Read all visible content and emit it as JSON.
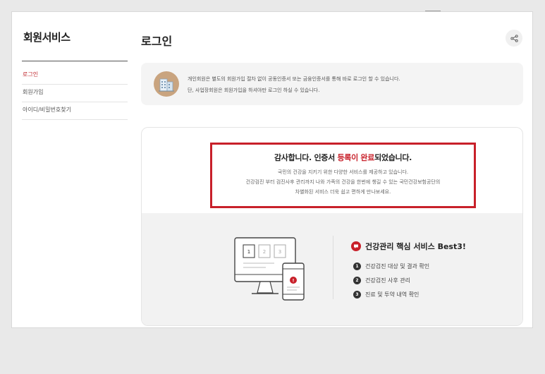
{
  "sidebar": {
    "title": "회원서비스",
    "items": [
      {
        "label": "로그인"
      },
      {
        "label": "회원가입"
      },
      {
        "label": "아이디/비밀번호찾기"
      }
    ]
  },
  "page": {
    "title": "로그인"
  },
  "notice": {
    "line1": "개인회원은 별도의 회원가입 절차 없이 공동인증서 또는 금융인증서를 통해 바로 로그인 할 수 있습니다.",
    "line2": "단, 사업장회원은 회원가입을 하셔야만 로그인 하실 수 있습니다."
  },
  "result": {
    "thanks_prefix": "감사합니다. 인증서 ",
    "thanks_accent": "등록이 완료",
    "thanks_suffix": "되었습니다.",
    "desc1": "국민의 건강을 지키기 위한 다양한 서비스를 제공하고 있습니다.",
    "desc2": "건강검진 부터 검진사후 관리까지 나와 가족의 건강을 한번에 챙길 수 있는 국민건강보험공단의",
    "desc3": "차별화된 서비스 더욱 쉽고 편하게 만나보세요."
  },
  "best": {
    "title": "건강관리 핵심 서비스 Best3!",
    "items": [
      {
        "num": "1",
        "label": "건강검진 대상 및 결과 확인"
      },
      {
        "num": "2",
        "label": "건강검진 사후 관리"
      },
      {
        "num": "3",
        "label": "진료 및 투약 내역 확인"
      }
    ]
  },
  "illustration": {
    "screen_boxes": [
      "1",
      "2",
      "3"
    ]
  },
  "colors": {
    "accent": "#c8202a",
    "sidebar_active": "#c0282e",
    "notice_bg": "#f4f4f4",
    "card_bottom_bg": "#f2f2f2"
  },
  "icons": {
    "share": "share-icon",
    "notice": "building-icon",
    "best": "speech-bubble-icon"
  }
}
